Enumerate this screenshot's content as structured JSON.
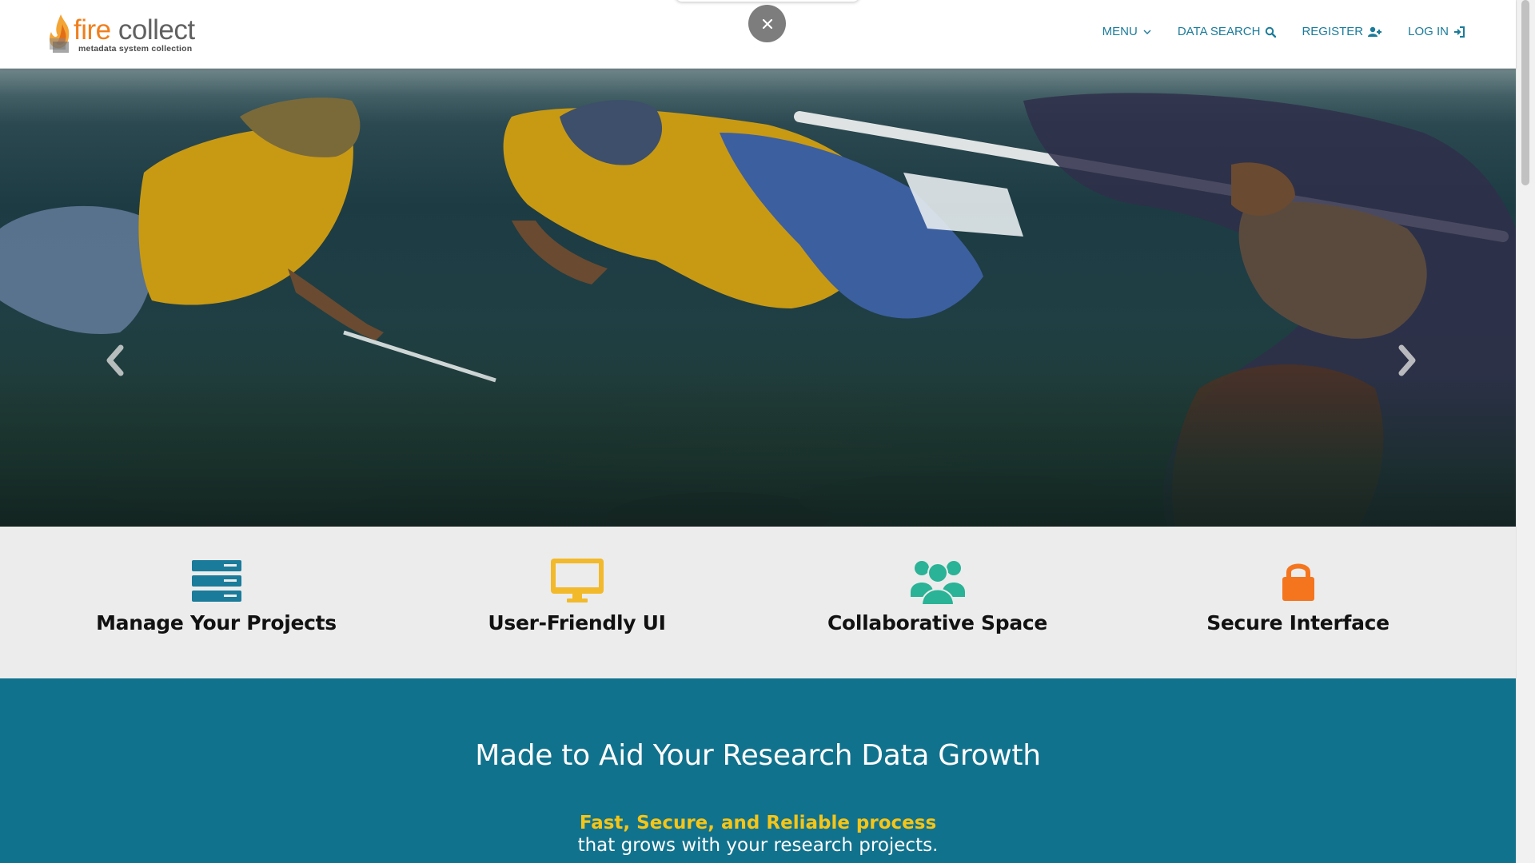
{
  "logo": {
    "word_part1": "fire",
    "word_part2": "collect",
    "tagline": "metadata system collection",
    "icon": "flame-logo-icon"
  },
  "nav": {
    "menu_label": "MENU",
    "data_search_label": "DATA SEARCH",
    "register_label": "REGISTER",
    "login_label": "LOG IN",
    "icons": {
      "menu": "chevron-down-icon",
      "data_search": "search-icon",
      "register": "user-plus-icon",
      "login": "sign-in-icon"
    }
  },
  "overlay": {
    "close_icon": "close-icon"
  },
  "hero": {
    "description": "underwater photo of snorkelers surveying a reef",
    "prev_icon": "chevron-left-icon",
    "next_icon": "chevron-right-icon"
  },
  "features": [
    {
      "title": "Manage Your Projects",
      "icon": "server-stack-icon",
      "color": "#1a7b9a"
    },
    {
      "title": "User-Friendly UI",
      "icon": "desktop-monitor-icon",
      "color": "#f2b92b"
    },
    {
      "title": "Collaborative Space",
      "icon": "users-group-icon",
      "color": "#2ab396"
    },
    {
      "title": "Secure Interface",
      "icon": "lock-icon",
      "color": "#f5751e"
    }
  ],
  "band": {
    "title": "Made to Aid Your Research Data Growth",
    "highlight": "Fast, Secure, and Reliable process",
    "subtitle": "that grows with your research projects."
  },
  "colors": {
    "brand_teal": "#11728d",
    "nav_link": "#1a7b9a",
    "logo_orange": "#f07f1d",
    "highlight_yellow": "#f5c518",
    "feature_bg": "#ececec"
  }
}
